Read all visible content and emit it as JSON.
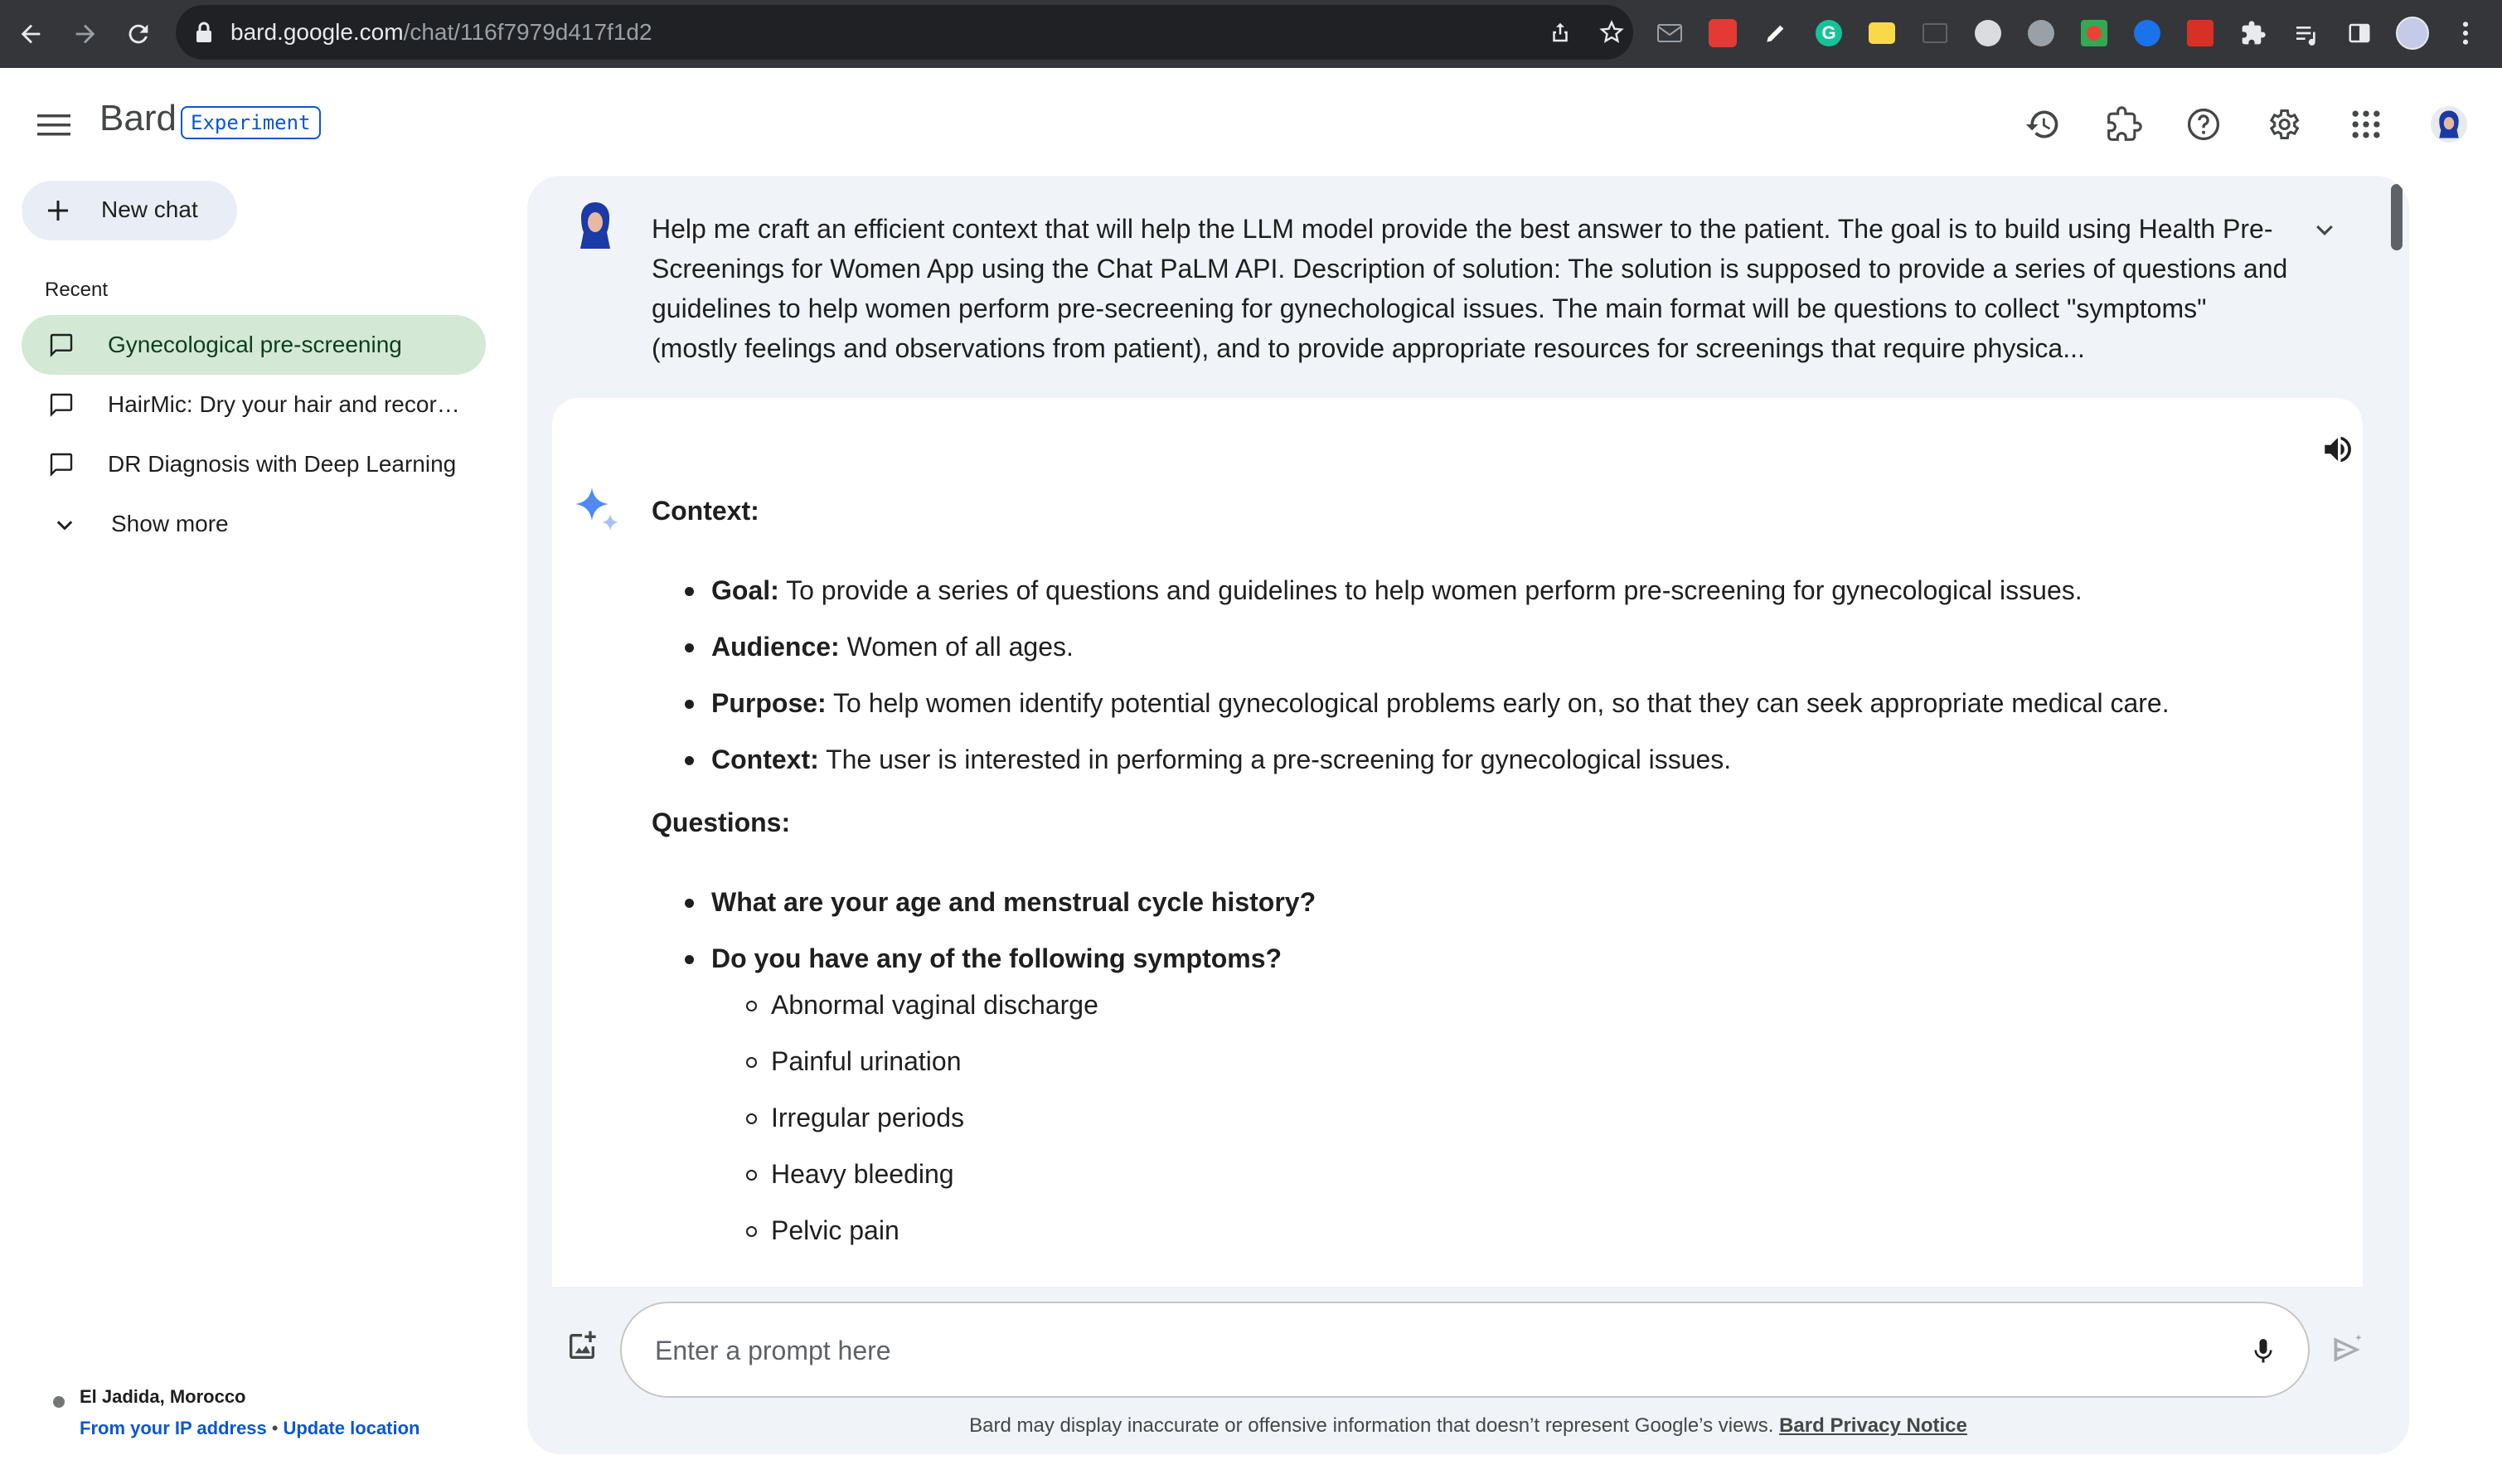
{
  "browser": {
    "url_host": "bard.google.com",
    "url_path": "/chat/116f7979d417f1d2",
    "icons": [
      "back-arrow-icon",
      "forward-arrow-icon",
      "reload-icon",
      "lock-icon",
      "share-icon",
      "star-icon"
    ],
    "extensions": [
      "mail-icon",
      "red-extension-icon",
      "pen-extension-icon",
      "grammarly-icon",
      "note-extension-icon",
      "blank-extension-icon",
      "circle-extension-icon",
      "gear-extension-icon",
      "video-extension-icon",
      "blue-extension-icon",
      "red-m-extension-icon",
      "puzzle-icon",
      "media-queue-icon",
      "sidepanel-icon",
      "profile-avatar-icon",
      "kebab-menu-icon"
    ]
  },
  "header": {
    "brand": "Bard",
    "badge": "Experiment",
    "icons": [
      "history-icon",
      "extensions-icon",
      "help-icon",
      "settings-icon",
      "apps-grid-icon",
      "account-avatar-icon"
    ]
  },
  "sidebar": {
    "new_chat": "New chat",
    "recent_label": "Recent",
    "items": [
      {
        "label": "Gynecological pre-screening",
        "active": true
      },
      {
        "label": "HairMic: Dry your hair and record audio",
        "active": false
      },
      {
        "label": "DR Diagnosis with Deep Learning",
        "active": false
      }
    ],
    "show_more": "Show more",
    "location": {
      "place": "El Jadida, Morocco",
      "source": "From your IP address",
      "separator": "•",
      "update": "Update location"
    }
  },
  "conversation": {
    "prompt": "Help me craft an efficient context that will help the LLM model provide the best answer to the patient. The goal is to build using Health Pre-Screenings for Women App using the Chat PaLM API. Description of solution: The solution is supposed to provide a series of questions and guidelines to help women perform pre-secreening for gynechological issues. The main format will be questions to collect \"symptoms\" (mostly feelings and observations from patient), and to provide appropriate resources for screenings that require physica...",
    "response": {
      "context_heading": "Context:",
      "context_items": [
        {
          "key": "Goal:",
          "text": " To provide a series of questions and guidelines to help women perform pre-screening for gynecological issues."
        },
        {
          "key": "Audience:",
          "text": " Women of all ages."
        },
        {
          "key": "Purpose:",
          "text": " To help women identify potential gynecological problems early on, so that they can seek appropriate medical care."
        },
        {
          "key": "Context:",
          "text": " The user is interested in performing a pre-screening for gynecological issues."
        }
      ],
      "questions_heading": "Questions:",
      "q1": "What are your age and menstrual cycle history?",
      "q2": "Do you have any of the following symptoms?",
      "symptoms": [
        "Abnormal vaginal discharge",
        "Painful urination",
        "Irregular periods",
        "Heavy bleeding",
        "Pelvic pain"
      ]
    }
  },
  "input": {
    "placeholder": "Enter a prompt here",
    "disclaimer": "Bard may display inaccurate or offensive information that doesn’t represent Google’s views.",
    "privacy_link": "Bard Privacy Notice"
  },
  "colors": {
    "chrome_bg": "#35363a",
    "omnibox_bg": "#202124",
    "main_bg": "#f0f4f9",
    "active_item_bg": "#d3e9d6",
    "new_chat_bg": "#e9eef6",
    "accent": "#0b57d0"
  }
}
